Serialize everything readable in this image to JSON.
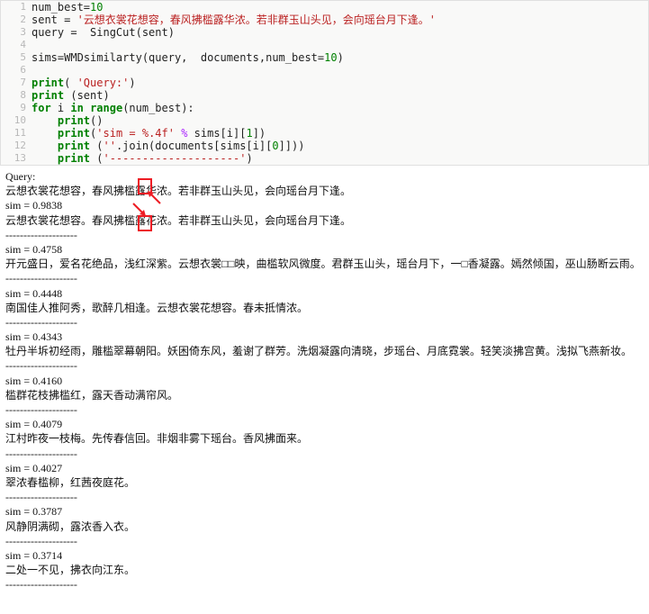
{
  "code": {
    "lines": [
      {
        "n": 1,
        "seg": [
          {
            "t": "num_best="
          },
          {
            "t": "10",
            "c": "num"
          }
        ]
      },
      {
        "n": 2,
        "seg": [
          {
            "t": "sent = "
          },
          {
            "t": "'云想衣裳花想容，春风拂槛露华浓。若非群玉山头见，会向瑶台月下逢。'",
            "c": "str"
          }
        ]
      },
      {
        "n": 3,
        "seg": [
          {
            "t": "query =  SingCut(sent)"
          }
        ]
      },
      {
        "n": 4,
        "seg": [
          {
            "t": ""
          }
        ]
      },
      {
        "n": 5,
        "seg": [
          {
            "t": "sims="
          },
          {
            "t": "WMD"
          },
          {
            "t": "similarty(query,  documents,num_best="
          },
          {
            "t": "10",
            "c": "num"
          },
          {
            "t": ")"
          }
        ]
      },
      {
        "n": 6,
        "seg": [
          {
            "t": ""
          }
        ]
      },
      {
        "n": 7,
        "seg": [
          {
            "t": "print",
            "c": "kw"
          },
          {
            "t": "( "
          },
          {
            "t": "'Query:'",
            "c": "str"
          },
          {
            "t": ")"
          }
        ]
      },
      {
        "n": 8,
        "seg": [
          {
            "t": "print",
            "c": "kw"
          },
          {
            "t": " (sent)"
          }
        ]
      },
      {
        "n": 9,
        "seg": [
          {
            "t": "for",
            "c": "kw"
          },
          {
            "t": " i "
          },
          {
            "t": "in",
            "c": "kw"
          },
          {
            "t": " "
          },
          {
            "t": "range",
            "c": "kw"
          },
          {
            "t": "(num_best):"
          }
        ]
      },
      {
        "n": 10,
        "seg": [
          {
            "t": "    "
          },
          {
            "t": "print",
            "c": "kw"
          },
          {
            "t": "()"
          }
        ]
      },
      {
        "n": 11,
        "seg": [
          {
            "t": "    "
          },
          {
            "t": "print",
            "c": "kw"
          },
          {
            "t": "("
          },
          {
            "t": "'sim = %.4f'",
            "c": "str"
          },
          {
            "t": " "
          },
          {
            "t": "%",
            "c": "op"
          },
          {
            "t": " sims[i]["
          },
          {
            "t": "1",
            "c": "num"
          },
          {
            "t": "])"
          }
        ]
      },
      {
        "n": 12,
        "seg": [
          {
            "t": "    "
          },
          {
            "t": "print",
            "c": "kw"
          },
          {
            "t": " ("
          },
          {
            "t": "''",
            "c": "str"
          },
          {
            "t": ".join(documents[sims[i]["
          },
          {
            "t": "0",
            "c": "num"
          },
          {
            "t": "]]))"
          }
        ]
      },
      {
        "n": 13,
        "seg": [
          {
            "t": "    "
          },
          {
            "t": "print",
            "c": "kw"
          },
          {
            "t": " ("
          },
          {
            "t": "'--------------------'",
            "c": "str"
          },
          {
            "t": ")"
          }
        ]
      }
    ]
  },
  "output": {
    "query_label": "Query:",
    "query_sent": "云想衣裳花想容，春风拂槛露华浓。若非群玉山头见，会向瑶台月下逢。",
    "sep": "--------------------",
    "results": [
      {
        "sim": "sim = 0.9838",
        "text": "云想衣裳花想容。春风拂槛露花浓。若非群玉山头见，会向瑶台月下逢。"
      },
      {
        "sim": "sim = 0.4758",
        "text": "开元盛日，爱名花绝品，浅红深紫。云想衣裳□□映，曲槛软风微度。君群玉山头，瑶台月下，一□香凝露。嫣然倾国，巫山肠断云雨。"
      },
      {
        "sim": "sim = 0.4448",
        "text": "南国佳人推阿秀，歌醉几相逢。云想衣裳花想容。春未抵情浓。"
      },
      {
        "sim": "sim = 0.4343",
        "text": "牡丹半坼初经雨，雕槛翠幕朝阳。妖困倚东风，羞谢了群芳。洗烟凝露向清晓，步瑶台、月底霓裳。轻笑淡拂宫黄。浅拟飞燕新妆。"
      },
      {
        "sim": "sim = 0.4160",
        "text": "槛群花枝拂槛红，露天香动满帘风。"
      },
      {
        "sim": "sim = 0.4079",
        "text": "江村昨夜一枝梅。先传春信回。非烟非雾下瑶台。香风拂面来。"
      },
      {
        "sim": "sim = 0.4027",
        "text": "翠浓春槛柳，红茜夜庭花。"
      },
      {
        "sim": "sim = 0.3787",
        "text": "风静阴满砌，露浓香入衣。"
      },
      {
        "sim": "sim = 0.3714",
        "text": "二处一不见，拂衣向江东。"
      }
    ]
  }
}
